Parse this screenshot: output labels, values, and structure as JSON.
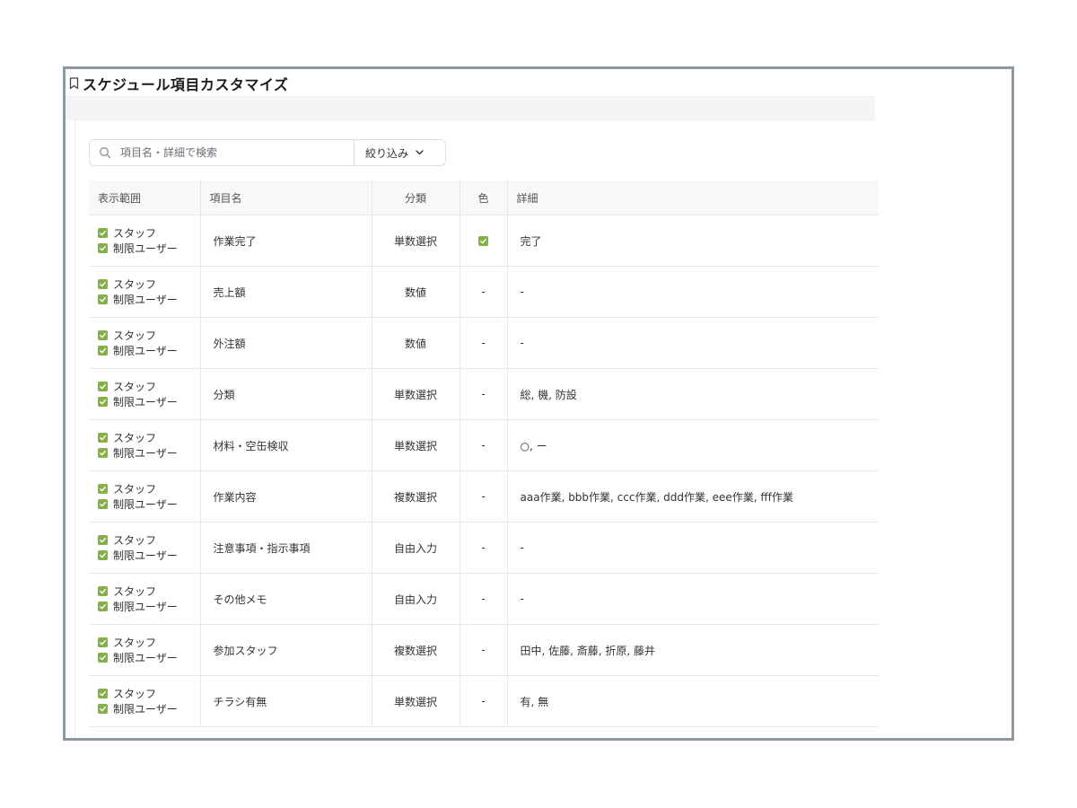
{
  "title": "スケジュール項目カスタマイズ",
  "search": {
    "placeholder": "項目名・詳細で検索"
  },
  "filter": {
    "label": "絞り込み"
  },
  "columns": {
    "scope": "表示範囲",
    "name": "項目名",
    "category": "分類",
    "color": "色",
    "detail": "詳細"
  },
  "accent_color": "#84b046",
  "rows": [
    {
      "scope": [
        "スタッフ",
        "制限ユーザー"
      ],
      "name": "作業完了",
      "category": "単数選択",
      "color": "check",
      "detail": "完了"
    },
    {
      "scope": [
        "スタッフ",
        "制限ユーザー"
      ],
      "name": "売上額",
      "category": "数値",
      "color": "-",
      "detail": "-"
    },
    {
      "scope": [
        "スタッフ",
        "制限ユーザー"
      ],
      "name": "外注額",
      "category": "数値",
      "color": "-",
      "detail": "-"
    },
    {
      "scope": [
        "スタッフ",
        "制限ユーザー"
      ],
      "name": "分類",
      "category": "単数選択",
      "color": "-",
      "detail": "総, 機, 防設"
    },
    {
      "scope": [
        "スタッフ",
        "制限ユーザー"
      ],
      "name": "材料・空缶検収",
      "category": "単数選択",
      "color": "-",
      "detail": "○, ー"
    },
    {
      "scope": [
        "スタッフ",
        "制限ユーザー"
      ],
      "name": "作業内容",
      "category": "複数選択",
      "color": "-",
      "detail": "aaa作業, bbb作業, ccc作業, ddd作業, eee作業, fff作業"
    },
    {
      "scope": [
        "スタッフ",
        "制限ユーザー"
      ],
      "name": "注意事項・指示事項",
      "category": "自由入力",
      "color": "-",
      "detail": "-"
    },
    {
      "scope": [
        "スタッフ",
        "制限ユーザー"
      ],
      "name": "その他メモ",
      "category": "自由入力",
      "color": "-",
      "detail": "-"
    },
    {
      "scope": [
        "スタッフ",
        "制限ユーザー"
      ],
      "name": "参加スタッフ",
      "category": "複数選択",
      "color": "-",
      "detail": "田中, 佐藤, 斎藤, 折原, 藤井"
    },
    {
      "scope": [
        "スタッフ",
        "制限ユーザー"
      ],
      "name": "チラシ有無",
      "category": "単数選択",
      "color": "-",
      "detail": "有, 無"
    }
  ]
}
